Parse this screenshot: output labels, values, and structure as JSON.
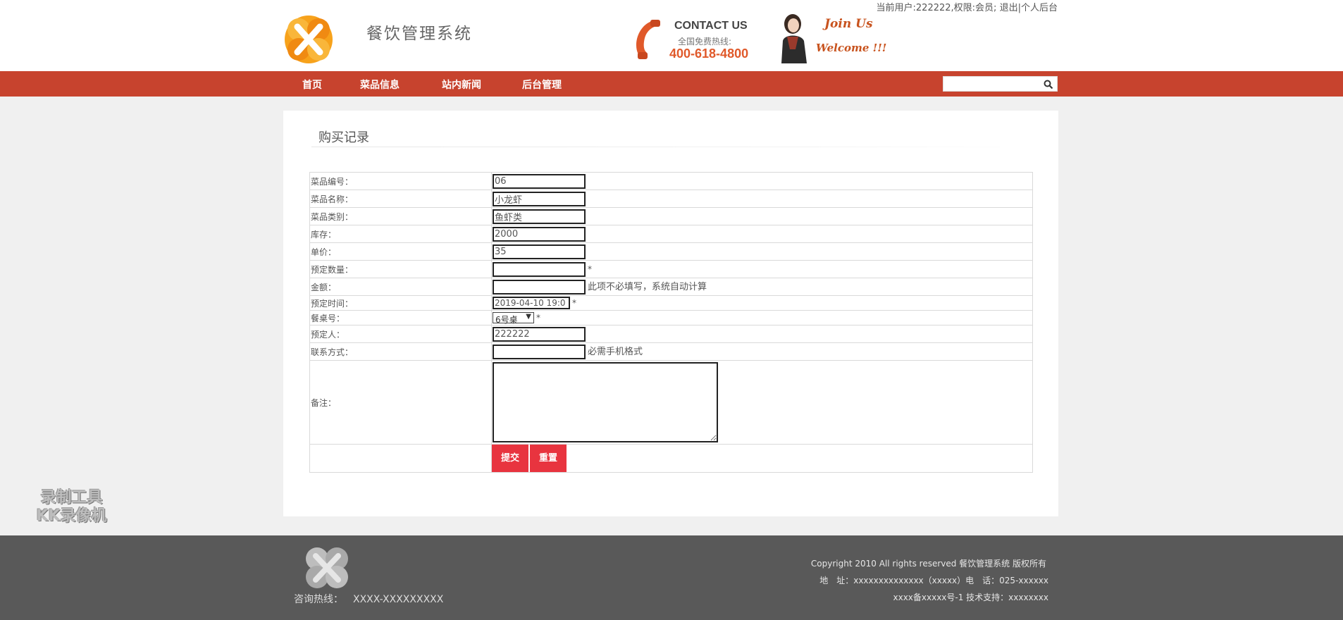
{
  "header": {
    "user_bar": {
      "user_text": "当前用户:222222,权限:会员;",
      "logout": "退出",
      "separator": "|",
      "personal": "个人后台"
    },
    "title": "餐饮管理系统",
    "contact": {
      "heading": "CONTACT US",
      "hotline_label": "全国免费热线:",
      "hotline_number": "400-618-4800"
    },
    "join": {
      "line1": "Join Us",
      "line2": "Welcome !!!"
    }
  },
  "nav": {
    "items": [
      {
        "label": "首页"
      },
      {
        "label": "菜品信息"
      },
      {
        "label": "站内新闻"
      },
      {
        "label": "后台管理"
      }
    ],
    "search": {
      "value": "",
      "placeholder": ""
    },
    "accent": "#c7432e"
  },
  "panel": {
    "title": "购买记录",
    "form": {
      "dish_no": {
        "label": "菜品编号：",
        "value": "06"
      },
      "dish_name": {
        "label": "菜品名称：",
        "value": "小龙虾"
      },
      "category": {
        "label": "菜品类别：",
        "value": "鱼虾类"
      },
      "stock": {
        "label": "库存：",
        "value": "2000"
      },
      "price": {
        "label": "单价：",
        "value": "35"
      },
      "quantity": {
        "label": "预定数量：",
        "value": "",
        "star": "*"
      },
      "amount": {
        "label": "金额：",
        "value": "",
        "hint": "此项不必填写，系统自动计算"
      },
      "time": {
        "label": "预定时间：",
        "value": "2019-04-10 19:0",
        "star": "*"
      },
      "table": {
        "label": "餐桌号：",
        "value": "6号桌",
        "arrow": "▼",
        "star": "*"
      },
      "person": {
        "label": "预定人：",
        "value": "222222"
      },
      "phone": {
        "label": "联系方式：",
        "value": "",
        "hint": "必需手机格式"
      },
      "notes": {
        "label": "备注：",
        "value": ""
      },
      "buttons": {
        "submit": "提交",
        "reset": "重置"
      }
    }
  },
  "footer": {
    "hotline_label": "咨询热线：",
    "hotline_number": "XXXX-XXXXXXXXX",
    "copyright": "Copyright 2010 All rights reserved 餐饮管理系统 版权所有",
    "address": "地　址：xxxxxxxxxxxxxx（xxxxx）电　话：025-xxxxxx",
    "icp": "xxxx备xxxxx号-1 技术支持：xxxxxxxx"
  },
  "watermark": {
    "line1": "录制工具",
    "line2": "KK录像机"
  }
}
